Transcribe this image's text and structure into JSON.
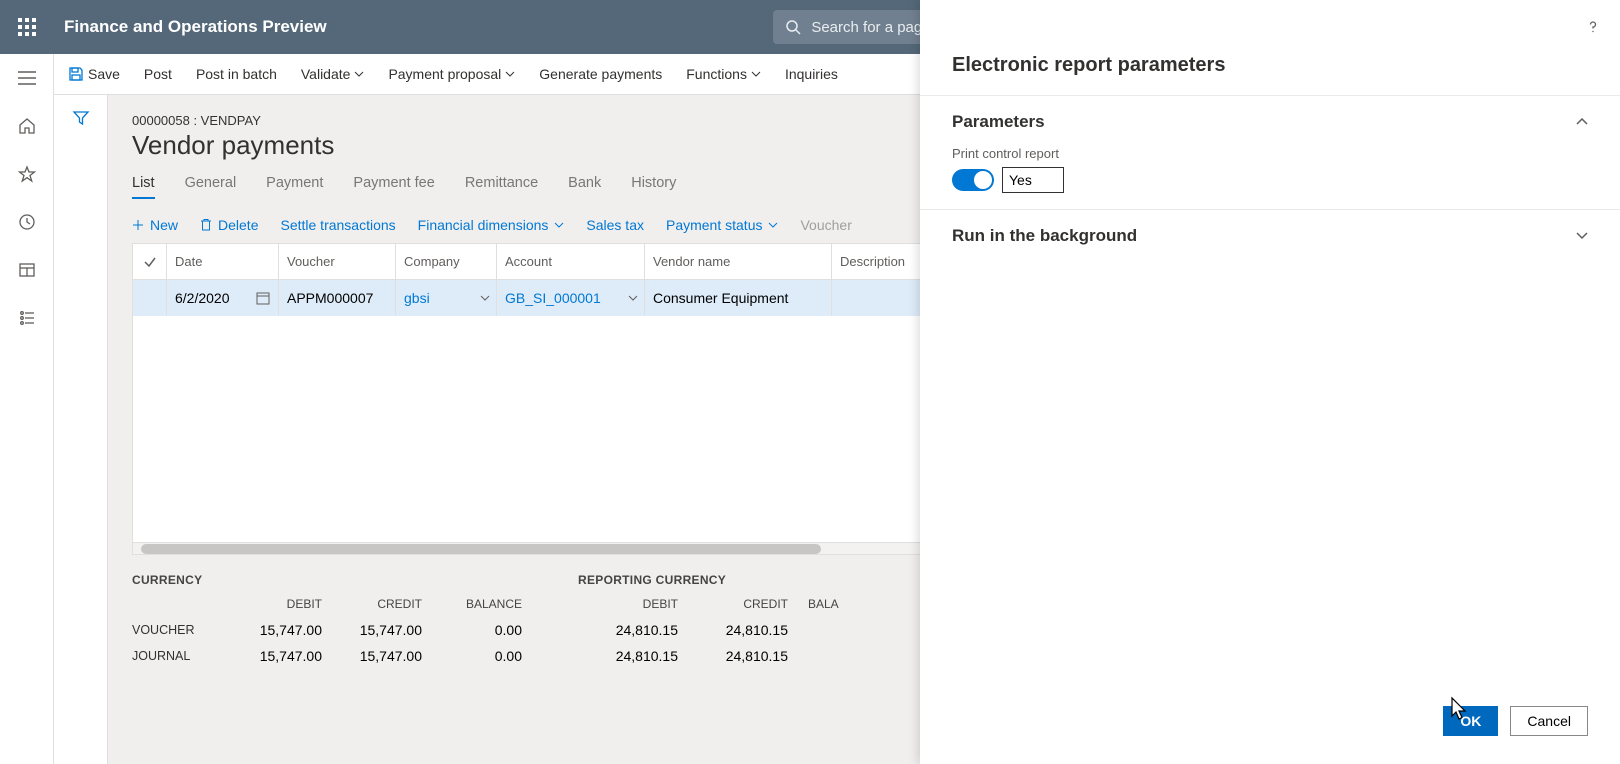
{
  "top": {
    "app_title": "Finance and Operations Preview",
    "search_placeholder": "Search for a page"
  },
  "actions": {
    "save": "Save",
    "post": "Post",
    "post_batch": "Post in batch",
    "validate": "Validate",
    "payment_proposal": "Payment proposal",
    "generate_payments": "Generate payments",
    "functions": "Functions",
    "inquiries": "Inquiries"
  },
  "page": {
    "crumb": "00000058 : VENDPAY",
    "title": "Vendor payments"
  },
  "tabs": {
    "list": "List",
    "general": "General",
    "payment": "Payment",
    "payment_fee": "Payment fee",
    "remittance": "Remittance",
    "bank": "Bank",
    "history": "History"
  },
  "grid_toolbar": {
    "new": "New",
    "delete": "Delete",
    "settle": "Settle transactions",
    "fin_dim": "Financial dimensions",
    "sales_tax": "Sales tax",
    "payment_status": "Payment status",
    "voucher": "Voucher"
  },
  "grid": {
    "headers": {
      "date": "Date",
      "voucher": "Voucher",
      "company": "Company",
      "account": "Account",
      "vendor": "Vendor name",
      "description": "Description"
    },
    "row": {
      "date": "6/2/2020",
      "voucher": "APPM000007",
      "company": "gbsi",
      "account": "GB_SI_000001",
      "vendor": "Consumer Equipment",
      "description": ""
    }
  },
  "totals": {
    "currency_title": "CURRENCY",
    "reporting_title": "REPORTING CURRENCY",
    "debit": "DEBIT",
    "credit": "CREDIT",
    "balance": "BALANCE",
    "voucher_label": "VOUCHER",
    "journal_label": "JOURNAL",
    "currency": {
      "voucher": {
        "debit": "15,747.00",
        "credit": "15,747.00",
        "balance": "0.00"
      },
      "journal": {
        "debit": "15,747.00",
        "credit": "15,747.00",
        "balance": "0.00"
      }
    },
    "reporting": {
      "voucher": {
        "debit": "24,810.15",
        "credit": "24,810.15",
        "balance": ""
      },
      "journal": {
        "debit": "24,810.15",
        "credit": "24,810.15",
        "balance": ""
      }
    },
    "balance_head_trunc": "BALA"
  },
  "panel": {
    "title": "Electronic report parameters",
    "section_parameters": "Parameters",
    "print_control_label": "Print control report",
    "print_control_value": "Yes",
    "section_background": "Run in the background",
    "ok": "OK",
    "cancel": "Cancel"
  }
}
